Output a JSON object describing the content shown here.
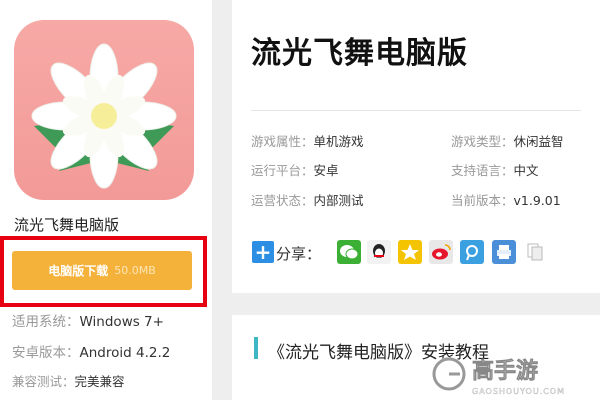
{
  "app": {
    "name": "流光飞舞电脑版",
    "download_label": "电脑版下载",
    "download_size": "50.0MB"
  },
  "info_rows": [
    {
      "key": "适用系统：",
      "value": "Windows 7+"
    },
    {
      "key": "安卓版本：",
      "value": "Android 4.2.2"
    },
    {
      "key": "兼容测试：",
      "value": "完美兼容"
    }
  ],
  "detail": {
    "title": "流光飞舞电脑版",
    "attrs": [
      {
        "key": "游戏属性：",
        "value": "单机游戏"
      },
      {
        "key": "游戏类型：",
        "value": "休闲益智"
      },
      {
        "key": "运行平台：",
        "value": "安卓"
      },
      {
        "key": "支持语言：",
        "value": "中文"
      },
      {
        "key": "运营状态：",
        "value": "内部测试"
      },
      {
        "key": "当前版本：",
        "value": "v1.9.01"
      }
    ],
    "share_label": "分享："
  },
  "share_icons": [
    {
      "name": "wechat-icon",
      "color": "#3cb034"
    },
    {
      "name": "qq-icon",
      "color": "#f2f2f2"
    },
    {
      "name": "qzone-icon",
      "color": "#f5c400"
    },
    {
      "name": "weibo-icon",
      "color": "#e8e8e8"
    },
    {
      "name": "tencent-weibo-icon",
      "color": "#3aa0e0"
    },
    {
      "name": "print-icon",
      "color": "#4a8fd8"
    },
    {
      "name": "copy-icon",
      "color": "#dddddd"
    }
  ],
  "guide": {
    "title": "《流光飞舞电脑版》安装教程"
  },
  "watermark": {
    "brand": "高手游",
    "url": "GAOSHOUYOU.COM"
  }
}
